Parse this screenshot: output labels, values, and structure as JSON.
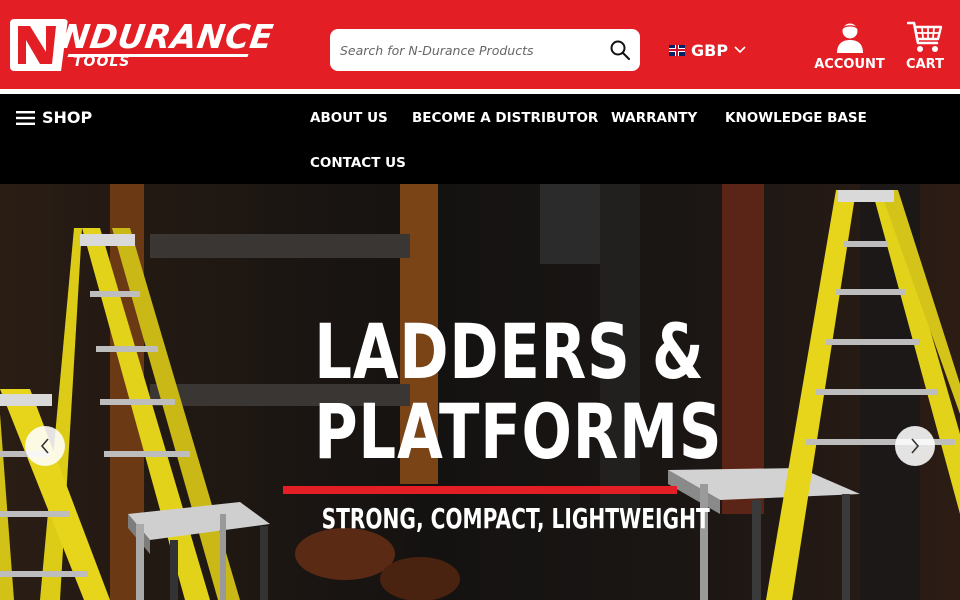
{
  "header": {
    "brand": {
      "name": "NDURANCE",
      "sub": "TOOLS"
    },
    "search": {
      "placeholder": "Search for N-Durance Products"
    },
    "currency": {
      "code": "GBP"
    },
    "account_label": "ACCOUNT",
    "cart_label": "CART",
    "colors": {
      "brand_red": "#e31e24"
    }
  },
  "nav": {
    "shop_label": "SHOP",
    "links": [
      {
        "label": "ABOUT US"
      },
      {
        "label": "BECOME A DISTRIBUTOR"
      },
      {
        "label": "WARRANTY"
      },
      {
        "label": "KNOWLEDGE BASE"
      },
      {
        "label": "CONTACT US"
      }
    ]
  },
  "hero": {
    "title_line1": "LADDERS &",
    "title_line2": "PLATFORMS",
    "subtitle": "STRONG, COMPACT, LIGHTWEIGHT"
  }
}
